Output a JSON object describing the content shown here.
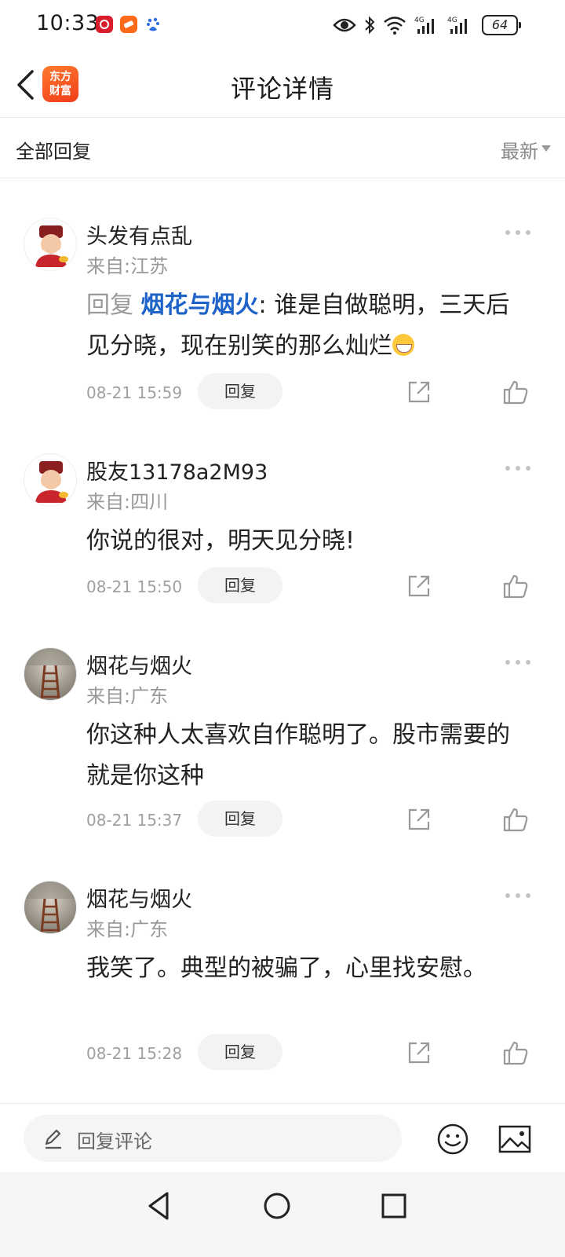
{
  "status_bar": {
    "time": "10:33",
    "battery": "64",
    "icons": [
      "app-red-icon",
      "app-orange-icon",
      "baidu-icon",
      "eye-icon",
      "bluetooth-icon",
      "wifi-icon",
      "signal-4g-icon",
      "signal-4g-icon"
    ]
  },
  "header": {
    "title": "评论详情",
    "logo_line1": "东方",
    "logo_line2": "财富"
  },
  "filter": {
    "label": "全部回复",
    "sort": "最新"
  },
  "comments": [
    {
      "username": "头发有点乱",
      "location": "来自:江苏",
      "reply_prefix": "回复 ",
      "reply_target": "烟花与烟火",
      "content": ": 谁是自做聪明，三天后见分晓，现在别笑的那么灿烂",
      "has_emoji": true,
      "time": "08-21 15:59",
      "reply_label": "回复"
    },
    {
      "username": "股友13178a2M93",
      "location": "来自:四川",
      "content": "你说的很对，明天见分晓!",
      "time": "08-21 15:50",
      "reply_label": "回复"
    },
    {
      "username": "烟花与烟火",
      "location": "来自:广东",
      "content": "你这种人太喜欢自作聪明了。股市需要的就是你这种",
      "time": "08-21 15:37",
      "reply_label": "回复"
    },
    {
      "username": "烟花与烟火",
      "location": "来自:广东",
      "content": "我笑了。典型的被骗了，心里找安慰。",
      "time": "08-21 15:28",
      "reply_label": "回复"
    }
  ],
  "input_bar": {
    "placeholder": "回复评论"
  },
  "colors": {
    "link": "#1e64c8",
    "brand": "#ef3d1a",
    "muted": "#999999"
  }
}
